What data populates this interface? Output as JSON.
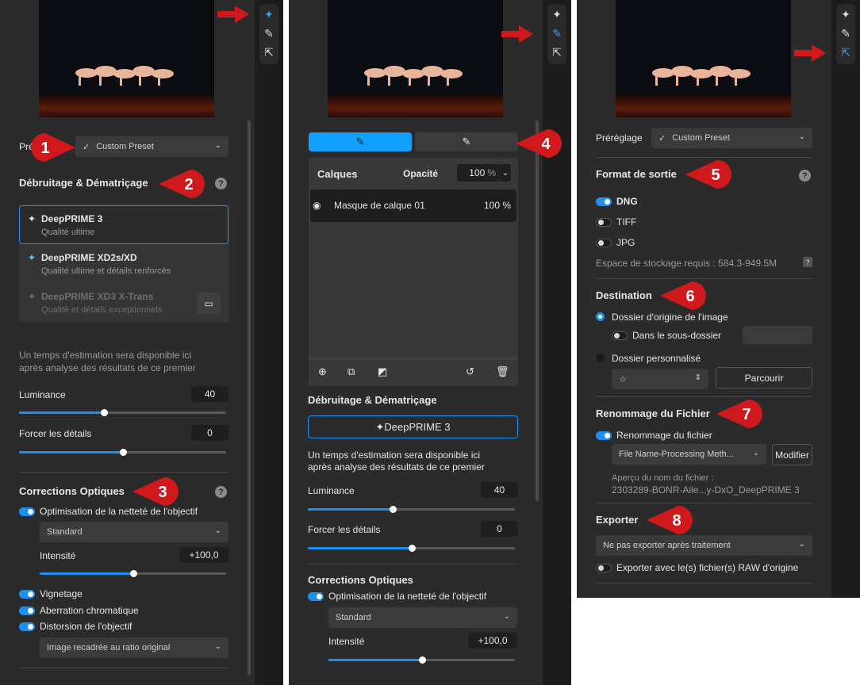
{
  "panel1": {
    "preset_label": "Pré",
    "preset_value": "Custom Preset",
    "denoise_title": "Débruitage & Dématriçage",
    "help": "?",
    "methods": [
      {
        "name": "DeepPRIME 3",
        "desc": "Qualité ultime"
      },
      {
        "name": "DeepPRIME XD2s/XD",
        "desc": "Qualité ultime et détails renforcés"
      },
      {
        "name": "DeepPRIME XD3 X-Trans",
        "desc": "Qualité et détails exceptionnels"
      }
    ],
    "estimate_text_1": "Un temps d'estimation sera disponible ici",
    "estimate_text_2": "après analyse des résultats de ce premier",
    "luminance_label": "Luminance",
    "luminance_value": "40",
    "luminance_level": 0.41,
    "details_label": "Forcer les détails",
    "details_value": "0",
    "details_level": 0.5,
    "optics_title": "Corrections Optiques",
    "sharpness_label": "Optimisation de la netteté de l'objectif",
    "sharpness_mode": "Standard",
    "intensity_label": "Intensité",
    "intensity_value": "+100,0",
    "intensity_level": 0.5,
    "vignetting_label": "Vignetage",
    "chromatic_label": "Aberration chromatique",
    "distortion_label": "Distorsion de l'objectif",
    "distortion_mode": "Image recadrée au ratio original"
  },
  "panel2": {
    "layers_label": "Calques",
    "opacity_label": "Opacité",
    "opacity_value": "100",
    "opacity_unit": "%",
    "layer_name": "Masque de calque 01",
    "layer_opacity": "100 %",
    "denoise_title": "Débruitage & Dématriçage",
    "method": "DeepPRIME 3",
    "estimate_text_1": "Un temps d'estimation sera disponible ici",
    "estimate_text_2": "après analyse des résultats de ce premier",
    "luminance_label": "Luminance",
    "luminance_value": "40",
    "luminance_level": 0.41,
    "details_label": "Forcer les détails",
    "details_value": "0",
    "details_level": 0.5,
    "optics_title": "Corrections Optiques",
    "sharpness_label": "Optimisation de la netteté de l'objectif",
    "sharpness_mode": "Standard",
    "intensity_label": "Intensité",
    "intensity_value": "+100,0",
    "intensity_level": 0.5
  },
  "panel3": {
    "preset_label": "Préréglage",
    "preset_value": "Custom Preset",
    "format_title": "Format de sortie",
    "help": "?",
    "formats": [
      "DNG",
      "TIFF",
      "JPG"
    ],
    "storage_label": "Espace de stockage requis : 584.3-949.5M",
    "storage_help": "?",
    "destination_title": "Destination",
    "dest_origin": "Dossier d'origine de l'image",
    "dest_subfolder": "Dans le sous-dossier",
    "dest_custom": "Dossier personnalisé",
    "dest_custom_value": "☆",
    "browse_label": "Parcourir",
    "rename_title": "Renommage du Fichier",
    "rename_toggle": "Renommage du fichier",
    "rename_pattern": "File Name-Processing Meth...",
    "modify_label": "Modifier",
    "preview_label": "Aperçu du nom du fichier :",
    "preview_value": "2303289-BONR-Aile...y-DxO_DeepPRIME 3",
    "export_title": "Exporter",
    "export_mode": "Ne pas exporter après traitement",
    "export_raw": "Exporter avec le(s) fichier(s) RAW d'origine"
  },
  "badges": [
    "1",
    "2",
    "3",
    "4",
    "5",
    "6",
    "7",
    "8"
  ],
  "colors": {
    "accent": "#1e8ef0",
    "badge": "#d0191c",
    "panel": "#2b2b2b"
  }
}
